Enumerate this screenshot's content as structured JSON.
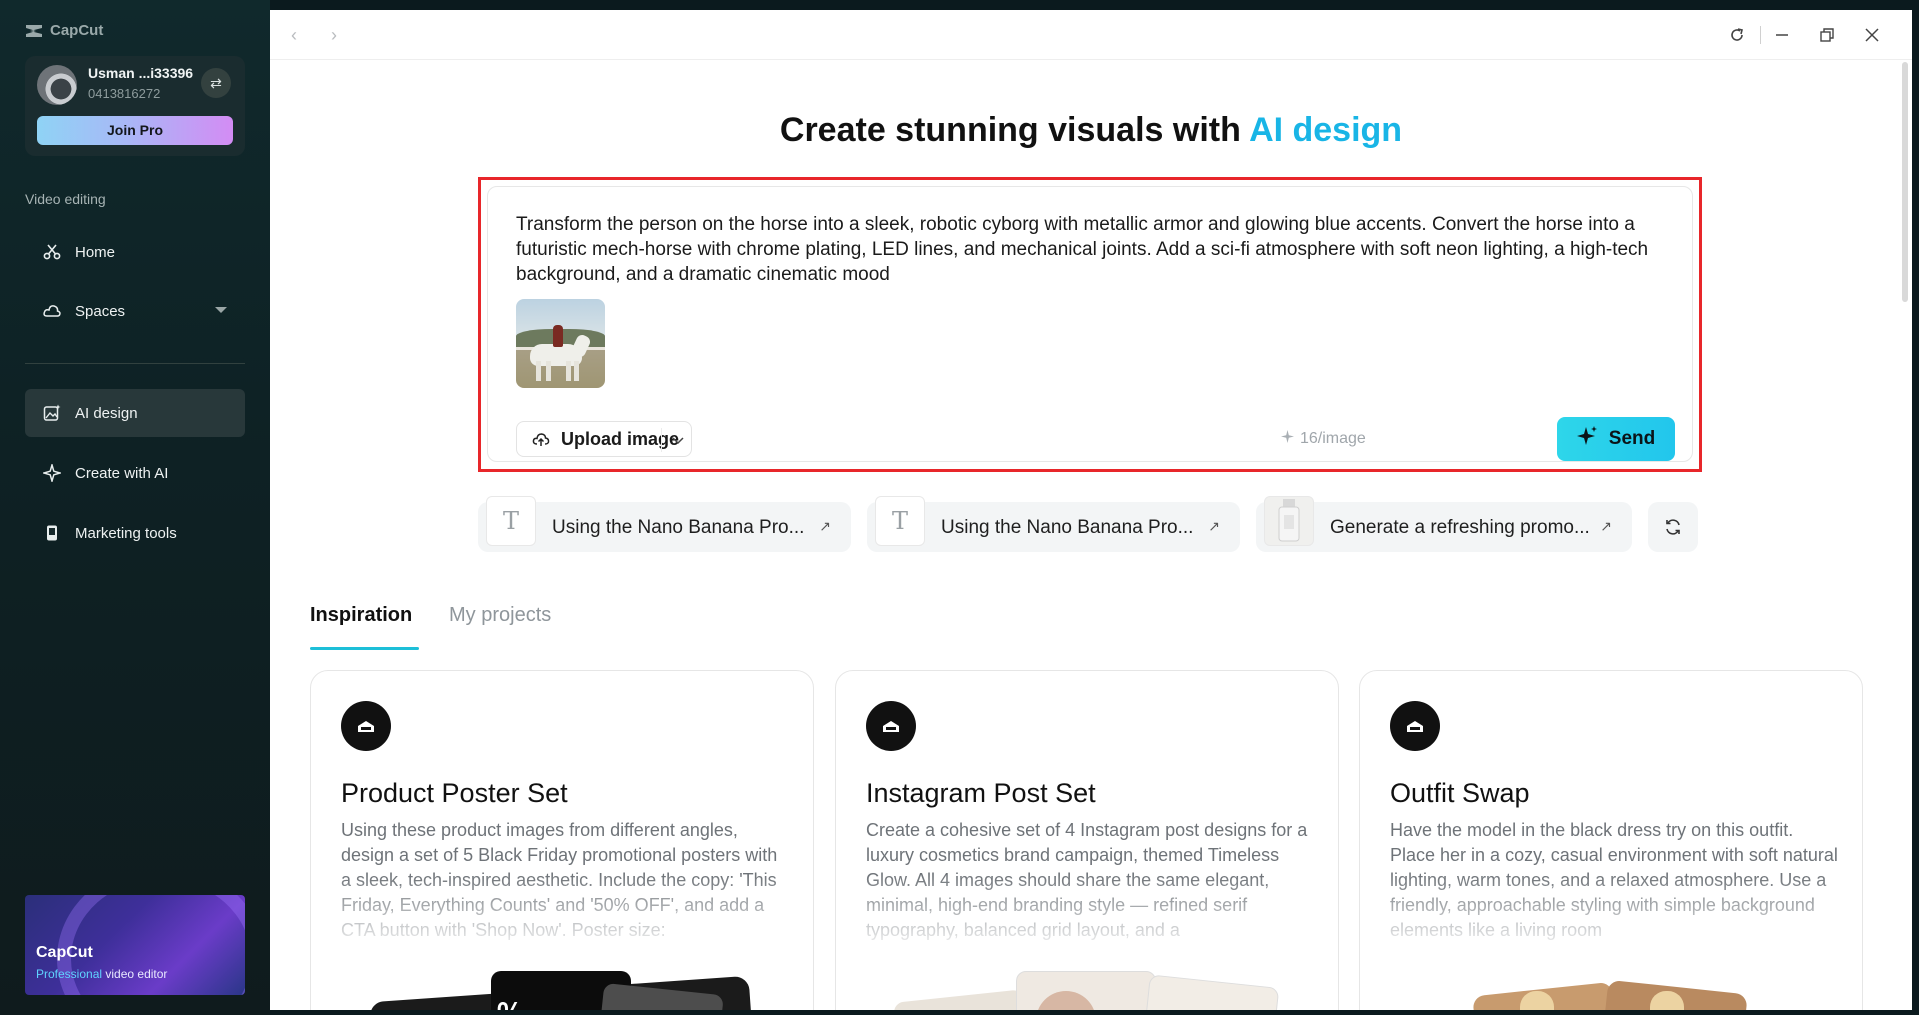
{
  "app": {
    "name": "CapCut"
  },
  "user": {
    "name": "Usman ...i33396",
    "id": "0413816272",
    "join_label": "Join Pro"
  },
  "sidebar": {
    "section_label": "Video editing",
    "items": [
      {
        "label": "Home",
        "icon": "scissors-icon"
      },
      {
        "label": "Spaces",
        "icon": "cloud-icon"
      },
      {
        "label": "AI design",
        "icon": "image-sparkle-icon",
        "active": true
      },
      {
        "label": "Create with AI",
        "icon": "sparkle-icon"
      },
      {
        "label": "Marketing tools",
        "icon": "phone-icon"
      }
    ],
    "promo": {
      "title": "CapCut",
      "sub_highlight": "Professional",
      "sub_rest": " video editor"
    }
  },
  "main": {
    "headline_prefix": "Create stunning visuals with ",
    "headline_accent": "AI design",
    "prompt_text": "Transform the person on the horse into a sleek, robotic cyborg with metallic armor and glowing blue accents. Convert the horse into a futuristic mech-horse with chrome plating, LED lines, and mechanical joints. Add a sci-fi atmosphere with soft neon lighting, a high-tech background, and a dramatic cinematic mood",
    "upload_label": "Upload image",
    "cost_label": "16/image",
    "send_label": "Send",
    "suggestions": [
      {
        "label": "Using the Nano Banana Pro..."
      },
      {
        "label": "Using the Nano Banana Pro..."
      },
      {
        "label": "Generate a refreshing promo..."
      }
    ],
    "tabs": [
      {
        "label": "Inspiration"
      },
      {
        "label": "My projects"
      }
    ],
    "cards": [
      {
        "title": "Product Poster Set",
        "desc": "Using these product images from different angles, design a set of 5 Black Friday promotional posters with a sleek, tech-inspired aesthetic. Include the copy: 'This Friday, Everything Counts' and '50% OFF', and add a CTA button with 'Shop Now'. Poster size:"
      },
      {
        "title": "Instagram Post Set",
        "desc": "Create a cohesive set of 4 Instagram post designs for a luxury cosmetics brand campaign, themed Timeless Glow. All 4 images should share the same elegant, minimal, high-end branding style — refined serif typography, balanced grid layout, and a"
      },
      {
        "title": "Outfit Swap",
        "desc": "Have the model in the black dress try on this outfit. Place her in a cozy, casual environment with soft natural lighting, warm tones, and a relaxed atmosphere. Use a friendly, approachable styling with simple background elements like a living room"
      }
    ]
  },
  "colors": {
    "accent": "#19b5e6",
    "send": "#2ed6ea",
    "highlight_border": "#e8262a"
  }
}
